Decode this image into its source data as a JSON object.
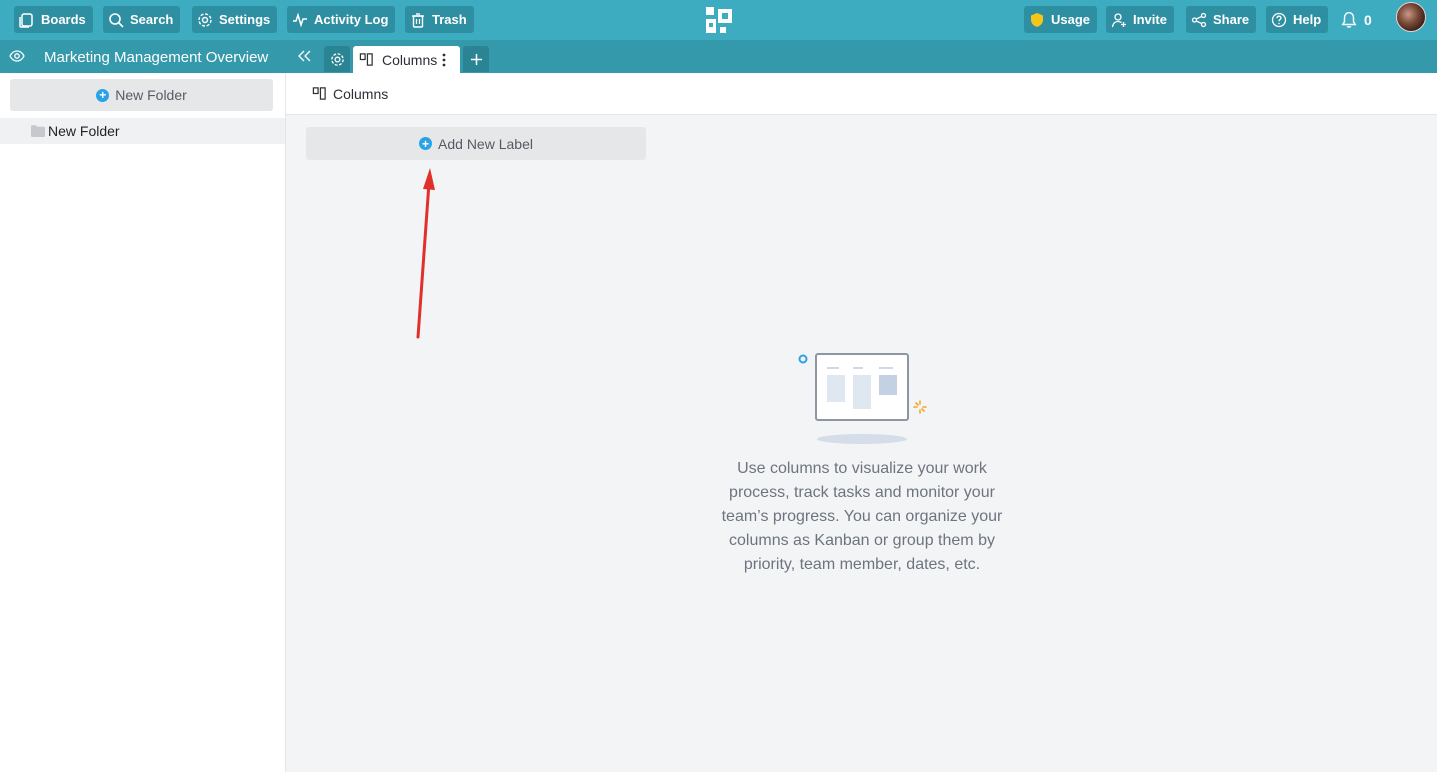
{
  "topbar": {
    "buttons": [
      {
        "label": "Boards",
        "icon": "boards-icon"
      },
      {
        "label": "Search",
        "icon": "search-icon"
      },
      {
        "label": "Settings",
        "icon": "gear-icon"
      },
      {
        "label": "Activity Log",
        "icon": "activity-icon"
      },
      {
        "label": "Trash",
        "icon": "trash-icon"
      }
    ],
    "right": {
      "usage": "Usage",
      "invite": "Invite",
      "share": "Share",
      "help": "Help",
      "notifications": "0"
    }
  },
  "subbar": {
    "board_name": "Marketing Management Overview",
    "active_tab": "Columns"
  },
  "sidebar": {
    "new_folder_button": "New Folder",
    "folders": [
      "New Folder"
    ]
  },
  "main": {
    "view_title": "Columns",
    "add_label_button": "Add New Label",
    "empty_state_text": "Use columns to visualize your work process, track tasks and monitor your team’s progress. You can organize your columns as Kanban or group them by priority, team member, dates, etc."
  },
  "colors": {
    "topbar": "#3eacc0",
    "subbar": "#3399ab",
    "accent_blue": "#2aa3e6",
    "arrow_red": "#e0302a",
    "usage_shield": "#f5c518"
  }
}
